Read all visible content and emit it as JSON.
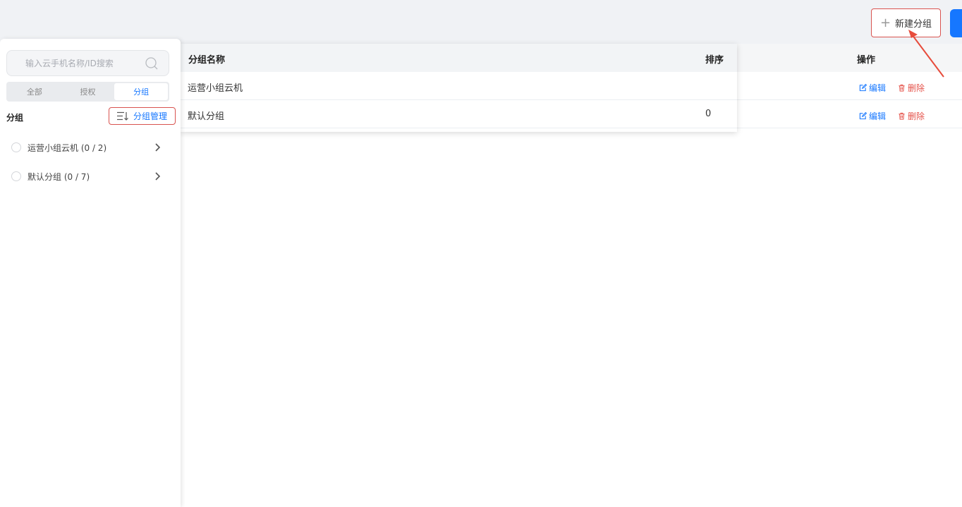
{
  "header": {
    "new_group_label": "新建分组"
  },
  "sidebar": {
    "search_placeholder": "输入云手机名称/ID搜索",
    "tabs": [
      {
        "label": "全部",
        "active": false
      },
      {
        "label": "授权",
        "active": false
      },
      {
        "label": "分组",
        "active": true
      }
    ],
    "section_title": "分组",
    "manage_label": "分组管理",
    "groups": [
      {
        "label": "运营小组云机 (0 / 2)"
      },
      {
        "label": "默认分组 (0 / 7)"
      }
    ]
  },
  "table": {
    "columns": {
      "name": "分组名称",
      "sort": "排序",
      "actions": "操作"
    },
    "rows": [
      {
        "name": "运营小组云机",
        "sort": ""
      },
      {
        "name": "默认分组",
        "sort": "0"
      }
    ],
    "edit_label": "编辑",
    "delete_label": "删除"
  },
  "colors": {
    "accent": "#1677ff",
    "danger": "#e5534b",
    "highlight": "#d9534f"
  }
}
